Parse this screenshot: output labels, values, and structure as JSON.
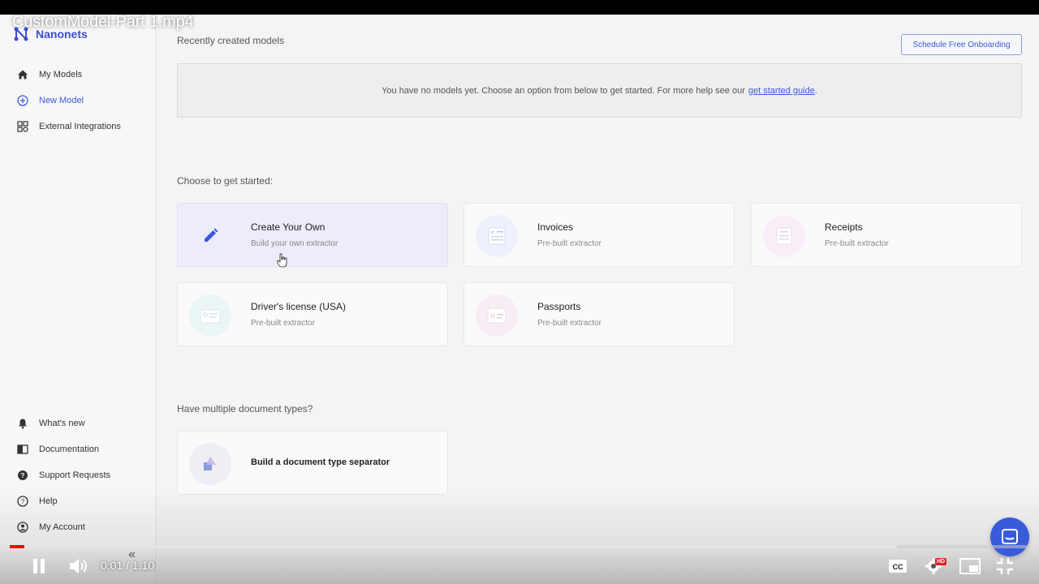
{
  "video": {
    "title": "CustomModel-Part 1.mp4",
    "time": "0:01 / 1:10",
    "progress": 0.014,
    "buffered": 0.87,
    "hd_badge": "HD"
  },
  "brand": {
    "name": "Nanonets"
  },
  "sidebar": {
    "top_items": [
      {
        "label": "My Models",
        "icon": "home-icon"
      },
      {
        "label": "New Model",
        "icon": "plus-circle-icon",
        "active": true
      },
      {
        "label": "External Integrations",
        "icon": "apps-icon"
      }
    ],
    "bottom_items": [
      {
        "label": "What's new",
        "icon": "bell-icon"
      },
      {
        "label": "Documentation",
        "icon": "book-icon"
      },
      {
        "label": "Support Requests",
        "icon": "question-circle-icon"
      },
      {
        "label": "Help",
        "icon": "help-icon"
      },
      {
        "label": "My Account",
        "icon": "account-icon"
      }
    ],
    "collapse_label": "«"
  },
  "main": {
    "recent_title": "Recently created models",
    "onboarding_button": "Schedule Free Onboarding",
    "empty_message": "You have no models yet. Choose an option from below to get started. For more help see our",
    "empty_link": "get started guide",
    "empty_suffix": ".",
    "choose_title": "Choose to get started:",
    "cards": [
      {
        "title": "Create Your Own",
        "subtitle": "Build your own extractor"
      },
      {
        "title": "Invoices",
        "subtitle": "Pre-built extractor"
      },
      {
        "title": "Receipts",
        "subtitle": "Pre-built extractor"
      },
      {
        "title": "Driver's license (USA)",
        "subtitle": "Pre-built extractor"
      },
      {
        "title": "Passports",
        "subtitle": "Pre-built extractor"
      }
    ],
    "multi_title": "Have multiple document types?",
    "separator_card": {
      "title": "Build a document type separator"
    }
  },
  "colors": {
    "accent": "#3a5bd9",
    "progress": "#ff0000"
  }
}
